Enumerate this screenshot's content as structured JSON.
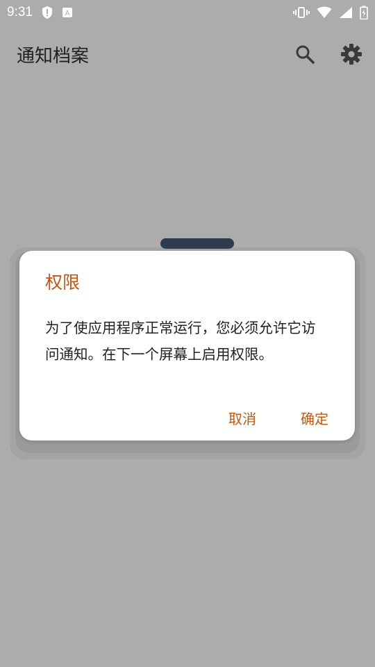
{
  "status_bar": {
    "time": "9:31",
    "icons_left": [
      "shield-alert-icon",
      "a-text-icon"
    ],
    "icons_right": [
      "vibrate-icon",
      "wifi-icon",
      "signal-icon",
      "battery-icon"
    ]
  },
  "app_bar": {
    "title": "通知档案",
    "actions": [
      "search-icon",
      "gear-icon"
    ]
  },
  "dialog": {
    "title": "权限",
    "message": "为了使应用程序正常运行，您必须允许它访问通知。在下一个屏幕上启用权限。",
    "cancel_label": "取消",
    "confirm_label": "确定"
  },
  "colors": {
    "scrim": "#acacac",
    "accent": "#c2570f",
    "handle": "#2e3b4e"
  }
}
